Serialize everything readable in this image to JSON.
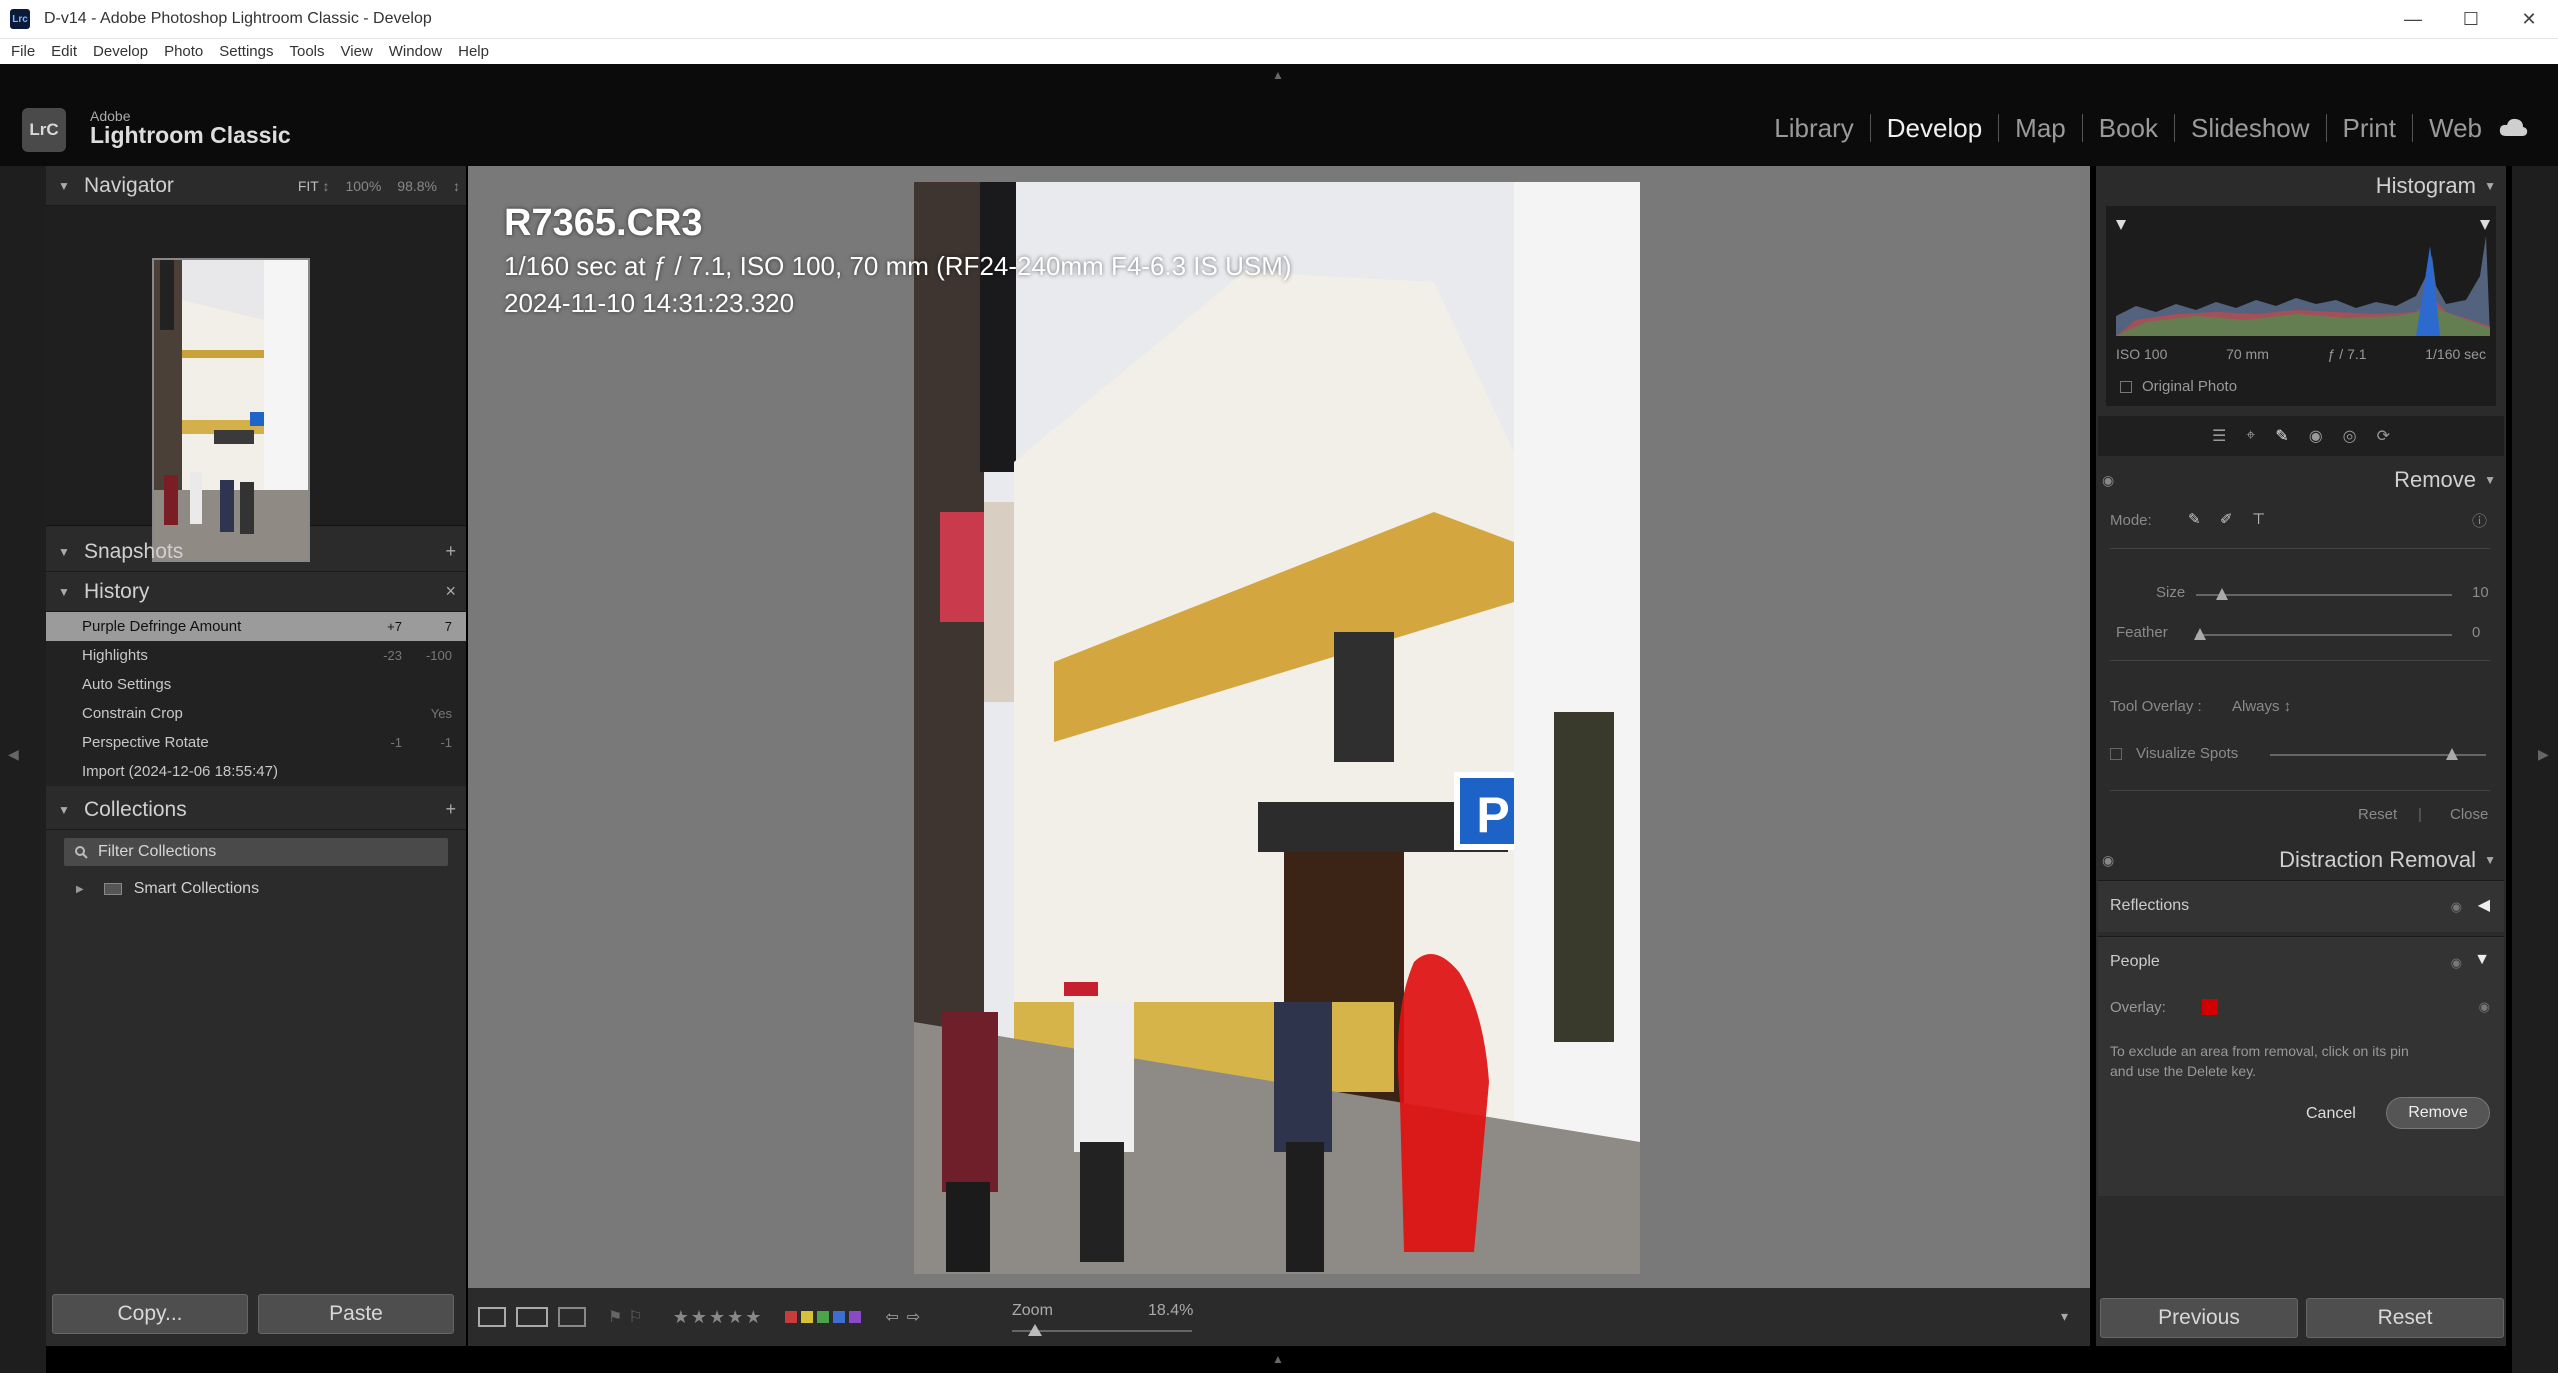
{
  "window": {
    "title": "D-v14 - Adobe Photoshop Lightroom Classic - Develop",
    "app_icon_text": "Lrc"
  },
  "menu": [
    "File",
    "Edit",
    "Develop",
    "Photo",
    "Settings",
    "Tools",
    "View",
    "Window",
    "Help"
  ],
  "brand": {
    "small": "Adobe",
    "big": "Lightroom Classic",
    "logo": "LrC"
  },
  "modules": [
    {
      "label": "Library",
      "active": false
    },
    {
      "label": "Develop",
      "active": true
    },
    {
      "label": "Map",
      "active": false
    },
    {
      "label": "Book",
      "active": false
    },
    {
      "label": "Slideshow",
      "active": false
    },
    {
      "label": "Print",
      "active": false
    },
    {
      "label": "Web",
      "active": false
    }
  ],
  "navigator": {
    "title": "Navigator",
    "fit": "FIT",
    "fit_arrow": "↕",
    "z100": "100%",
    "z988": "98.8%",
    "menu": "↕"
  },
  "snapshots": {
    "title": "Snapshots",
    "add": "+"
  },
  "history": {
    "title": "History",
    "clear": "×",
    "items": [
      {
        "label": "Purple Defringe Amount",
        "v1": "+7",
        "v2": "7",
        "selected": true
      },
      {
        "label": "Highlights",
        "v1": "-23",
        "v2": "-100",
        "selected": false
      },
      {
        "label": "Auto Settings",
        "v1": "",
        "v2": "",
        "selected": false
      },
      {
        "label": "Constrain Crop",
        "v1": "",
        "v2": "Yes",
        "selected": false
      },
      {
        "label": "Perspective Rotate",
        "v1": "-1",
        "v2": "-1",
        "selected": false
      },
      {
        "label": "Import (2024-12-06 18:55:47)",
        "v1": "",
        "v2": "",
        "selected": false
      }
    ]
  },
  "collections": {
    "title": "Collections",
    "add": "+",
    "filter": "Filter Collections",
    "smart": "Smart Collections"
  },
  "left_buttons": {
    "copy": "Copy...",
    "paste": "Paste"
  },
  "image_info": {
    "filename": "R7365.CR3",
    "exposure": "1/160 sec at ƒ / 7.1, ISO 100, 70 mm (RF24-240mm F4-6.3 IS USM)",
    "datetime": "2024-11-10 14:31:23.320"
  },
  "toolbar": {
    "stars": "★★★★★",
    "zoom_label": "Zoom",
    "zoom_value": "18.4%",
    "zoom_fraction": 0.1,
    "color_labels": [
      "#c83c3c",
      "#d6c23a",
      "#4aa54a",
      "#3c6fd0",
      "#8a4ac8"
    ],
    "dropdown": "▾"
  },
  "histogram": {
    "title": "Histogram",
    "iso": "ISO 100",
    "focal": "70 mm",
    "aperture": "ƒ / 7.1",
    "shutter": "1/160 sec",
    "original_photo": "Original Photo"
  },
  "remove": {
    "title": "Remove",
    "mode_label": "Mode:",
    "size_label": "Size",
    "size_value": "10",
    "size_fraction": 0.1,
    "feather_label": "Feather",
    "feather_value": "0",
    "feather_fraction": 0.0,
    "tool_overlay_label": "Tool Overlay :",
    "tool_overlay_value": "Always ↕",
    "visualize_spots": "Visualize Spots",
    "visualize_fraction": 0.85,
    "reset": "Reset",
    "separator": "|",
    "close": "Close"
  },
  "distraction": {
    "title": "Distraction Removal",
    "reflections": "Reflections",
    "people": "People",
    "overlay_label": "Overlay:",
    "overlay_color": "#d10000",
    "help_text_1": "To exclude an area from removal, click on its pin",
    "help_text_2": "and use the Delete key.",
    "cancel": "Cancel",
    "remove": "Remove"
  },
  "right_buttons": {
    "previous": "Previous",
    "reset": "Reset"
  }
}
